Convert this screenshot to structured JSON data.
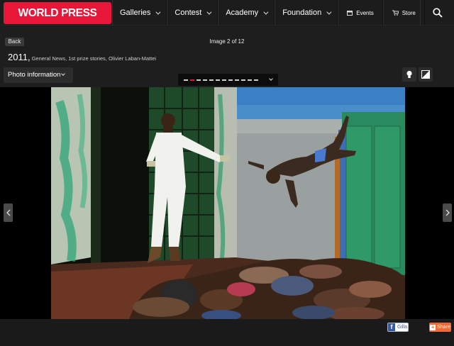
{
  "header": {
    "logo": "WORLD PRESS PHOTO",
    "nav": [
      {
        "label": "Galleries"
      },
      {
        "label": "Contest"
      },
      {
        "label": "Academy"
      },
      {
        "label": "Foundation"
      }
    ],
    "events_label": "Events",
    "store_label": "Store"
  },
  "gallery": {
    "back_label": "Back",
    "counter": "Image 2 of 12",
    "year": "2011,",
    "meta": "General News, 1st prize stories, Olivier Laban-Mattei",
    "photo_info_label": "Photo information",
    "current_index": 2,
    "total": 12
  },
  "footer": {
    "facebook_label": "Gilla",
    "share_label": "Share"
  },
  "colors": {
    "brand": "#e8173a",
    "share": "#f06a35",
    "facebook": "#3b5998"
  }
}
